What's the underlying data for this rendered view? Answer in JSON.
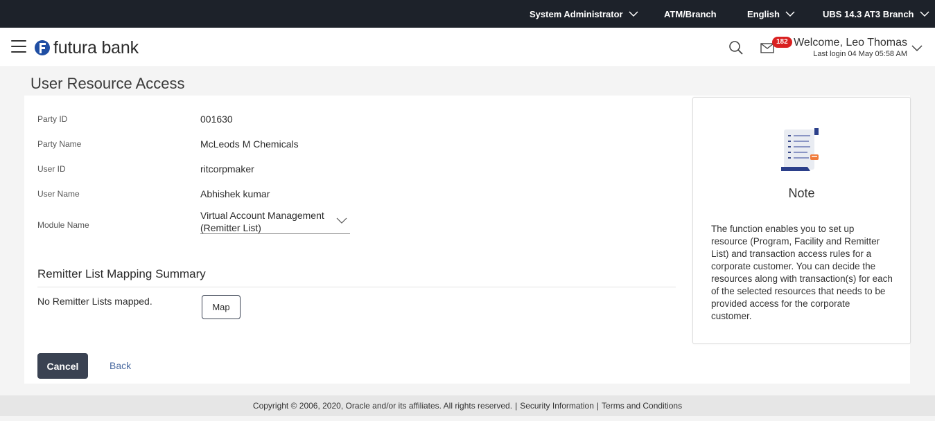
{
  "topbar": {
    "role": "System Administrator",
    "atm_branch": "ATM/Branch",
    "language": "English",
    "branch": "UBS 14.3 AT3 Branch"
  },
  "header": {
    "logo_text": "futura bank",
    "notification_count": "182",
    "welcome": "Welcome, Leo Thomas",
    "last_login": "Last login 04 May 05:58 AM"
  },
  "page": {
    "title": "User Resource Access"
  },
  "form": {
    "fields": [
      {
        "label": "Party ID",
        "value": "001630"
      },
      {
        "label": "Party Name",
        "value": "McLeods M Chemicals"
      },
      {
        "label": "User ID",
        "value": "ritcorpmaker"
      },
      {
        "label": "User Name",
        "value": "Abhishek kumar"
      }
    ],
    "module": {
      "label": "Module Name",
      "value": "Virtual Account Management (Remitter List)"
    }
  },
  "summary": {
    "title": "Remitter List Mapping Summary",
    "empty_text": "No Remitter Lists mapped.",
    "map_label": "Map"
  },
  "actions": {
    "cancel_label": "Cancel",
    "back_label": "Back"
  },
  "note": {
    "title": "Note",
    "text": "The function enables you to set up resource (Program, Facility and Remitter List) and transaction access rules for a corporate customer. You can decide the resources along with transaction(s) for each of the selected resources that needs to be provided access for the corporate customer."
  },
  "footer": {
    "copyright": "Copyright © 2006, 2020, Oracle and/or its affiliates. All rights reserved.",
    "sep": "|",
    "security": "Security Information",
    "terms": "Terms and Conditions"
  },
  "colors": {
    "topbar_bg": "#1d222a",
    "button_primary": "#3a4252",
    "badge": "#d92121",
    "link": "#4a6aa0",
    "logo_blue": "#1f4ea3"
  },
  "icons": [
    "hamburger-icon",
    "futura-logo-icon",
    "chevron-down-icon",
    "search-icon",
    "mail-icon",
    "note-document-icon"
  ]
}
